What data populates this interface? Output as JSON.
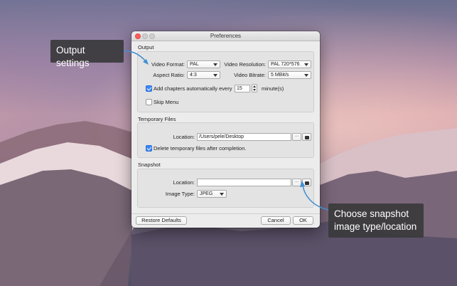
{
  "window": {
    "title": "Preferences"
  },
  "output": {
    "section_label": "Output",
    "video_format_label": "Video Format:",
    "video_format_value": "PAL",
    "video_resolution_label": "Video Resolution:",
    "video_resolution_value": "PAL 720*576",
    "aspect_ratio_label": "Aspect Ratio:",
    "aspect_ratio_value": "4:3",
    "video_bitrate_label": "Video Bitrate:",
    "video_bitrate_value": "5 MBit/s",
    "add_chapters_label": "Add chapters automatically every",
    "add_chapters_checked": true,
    "chapter_interval_value": "15",
    "chapter_interval_unit": "minute(s)",
    "skip_menu_label": "Skip Menu",
    "skip_menu_checked": false
  },
  "temporary_files": {
    "section_label": "Temporary Files",
    "location_label": "Location:",
    "location_value": "/Users/pele/Desktop",
    "browse_label": "···",
    "delete_label": "Delete temporary files after completion.",
    "delete_checked": true
  },
  "snapshot": {
    "section_label": "Snapshot",
    "location_label": "Location:",
    "location_value": "",
    "browse_label": "···",
    "image_type_label": "Image Type:",
    "image_type_value": "JPEG"
  },
  "footer": {
    "restore_defaults_label": "Restore Defaults",
    "cancel_label": "Cancel",
    "ok_label": "OK"
  },
  "callouts": {
    "output_settings": "Output settings",
    "snapshot_line1": "Choose snapshot",
    "snapshot_line2": "image type/location"
  },
  "colors": {
    "checkbox_accent": "#3b86f7",
    "callout_bg": "#3a3a3c",
    "arrow": "#3f8fd2"
  },
  "icons": [
    "close-icon",
    "minimize-icon",
    "zoom-icon",
    "ellipsis-icon",
    "folder-icon",
    "chevron-down-icon",
    "stepper-icon",
    "checkmark-icon"
  ]
}
